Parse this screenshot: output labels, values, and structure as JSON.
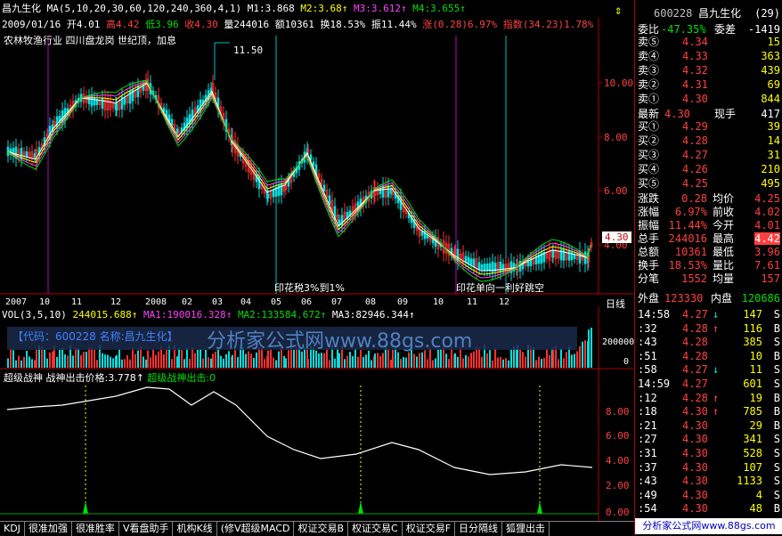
{
  "main": {
    "stock_name": "昌九生化",
    "ma_label": "MA(5,10,20,30,60,120,240,360,4,1)",
    "m1": "M1:3.868",
    "m2": "M2:3.68",
    "m3": "M3:3.612",
    "m4": "M4:3.655",
    "date": "2009/01/16",
    "open": "开4.01",
    "high": "高4.42",
    "low": "低3.96",
    "close": "收4.30",
    "volume": "量244016",
    "amount": "额10361",
    "turnover": "换18.53%",
    "amplitude": "振11.44%",
    "change": "涨(0.28)6.97%",
    "index": "指数(34.23)1.78%",
    "info_line": "农林牧渔行业 四川盘龙岗 世纪顶，加息",
    "peak_label": "11.50",
    "price_right": "4.30",
    "annotation1": "印花税3%到1%",
    "annotation2": "印花单向一利好跳空",
    "y_ticks": [
      "10.00",
      "8.00",
      "6.00",
      "4.00"
    ],
    "x_labels": [
      "2007",
      "10",
      "11",
      "12",
      "2008",
      "02",
      "03",
      "04",
      "05",
      "06",
      "07",
      "08",
      "09",
      "10",
      "11",
      "12"
    ],
    "period_label": "日线"
  },
  "vol": {
    "label": "VOL(3,5,10)",
    "v": "244015.688",
    "ma1": "MA1:190016.328",
    "ma2": "MA2:133584.672",
    "ma3": "MA3:82946.344",
    "code_box": "【代码：600228 名称:昌九生化】",
    "watermark": "分析家公式网www.88gs.com",
    "y_tick": "200000",
    "y_zero": "0"
  },
  "indicator": {
    "name": "超级战神",
    "value": "战神出击价格:3.778",
    "signal": "超级战神出击:0",
    "y_ticks": [
      "8.00",
      "6.00",
      "4.00",
      "2.00",
      "0.00"
    ]
  },
  "quote": {
    "code": "600228",
    "name": "昌九生化",
    "count": "(29)",
    "weibi_label": "委比",
    "weibi": "-47.35%",
    "weicha_label": "委差",
    "weicha": "-1419",
    "asks": [
      {
        "label": "卖⑤",
        "price": "4.34",
        "vol": "15"
      },
      {
        "label": "卖④",
        "price": "4.33",
        "vol": "363"
      },
      {
        "label": "卖③",
        "price": "4.32",
        "vol": "439"
      },
      {
        "label": "卖②",
        "price": "4.31",
        "vol": "69"
      },
      {
        "label": "卖①",
        "price": "4.30",
        "vol": "844"
      }
    ],
    "last_label": "最新",
    "last": "4.30",
    "now_label": "现手",
    "now": "417",
    "bids": [
      {
        "label": "买①",
        "price": "4.29",
        "vol": "39"
      },
      {
        "label": "买②",
        "price": "4.28",
        "vol": "14"
      },
      {
        "label": "买③",
        "price": "4.27",
        "vol": "31"
      },
      {
        "label": "买④",
        "price": "4.26",
        "vol": "210"
      },
      {
        "label": "买⑤",
        "price": "4.25",
        "vol": "495"
      }
    ],
    "stats": [
      {
        "k1": "涨跌",
        "v1": "0.28",
        "k2": "均价",
        "v2": "4.25"
      },
      {
        "k1": "涨幅",
        "v1": "6.97%",
        "k2": "前收",
        "v2": "4.02"
      },
      {
        "k1": "振幅",
        "v1": "11.44%",
        "k2": "今开",
        "v2": "4.01"
      },
      {
        "k1": "总手",
        "v1": "244016",
        "k2": "最高",
        "v2": "4.42"
      },
      {
        "k1": "总额",
        "v1": "10361",
        "k2": "最低",
        "v2": "3.96"
      },
      {
        "k1": "换手",
        "v1": "18.53%",
        "k2": "量比",
        "v2": "7.61"
      },
      {
        "k1": "分笔",
        "v1": "1552",
        "k2": "均量",
        "v2": "157"
      }
    ],
    "outer_label": "外盘",
    "outer": "123330",
    "inner_label": "内盘",
    "inner": "120686",
    "ticks": [
      {
        "t": "14:58",
        "p": "4.27",
        "d": "↓",
        "v": "147",
        "s": "S"
      },
      {
        "t": ":32",
        "p": "4.28",
        "d": "↑",
        "v": "116",
        "s": "B"
      },
      {
        "t": ":43",
        "p": "4.28",
        "d": "",
        "v": "385",
        "s": "S"
      },
      {
        "t": ":51",
        "p": "4.28",
        "d": "",
        "v": "10",
        "s": "B"
      },
      {
        "t": ":58",
        "p": "4.27",
        "d": "↓",
        "v": "11",
        "s": "S"
      },
      {
        "t": "14:59",
        "p": "4.27",
        "d": "",
        "v": "601",
        "s": "S"
      },
      {
        "t": ":12",
        "p": "4.28",
        "d": "↑",
        "v": "19",
        "s": "B"
      },
      {
        "t": ":18",
        "p": "4.30",
        "d": "↑",
        "v": "785",
        "s": "B"
      },
      {
        "t": ":21",
        "p": "4.30",
        "d": "",
        "v": "29",
        "s": "B"
      },
      {
        "t": ":27",
        "p": "4.30",
        "d": "",
        "v": "341",
        "s": "S"
      },
      {
        "t": ":31",
        "p": "4.30",
        "d": "",
        "v": "528",
        "s": "S"
      },
      {
        "t": ":37",
        "p": "4.30",
        "d": "",
        "v": "107",
        "s": "S"
      },
      {
        "t": ":43",
        "p": "4.30",
        "d": "",
        "v": "1133",
        "s": "S"
      },
      {
        "t": ":49",
        "p": "4.30",
        "d": "",
        "v": "4",
        "s": "S"
      },
      {
        "t": ":54",
        "p": "4.30",
        "d": "",
        "v": "48",
        "s": "B"
      }
    ],
    "footer_watermark": "分析家公式网www.88gs.com"
  },
  "tabs": [
    "KDJ",
    "很准加强",
    "很准胜率",
    "V看盘助手",
    "机构K线",
    "(修V超级MACD",
    "权证交易B",
    "权证交易C",
    "权证交易F",
    "日分隔线",
    "狐狸出击"
  ]
}
